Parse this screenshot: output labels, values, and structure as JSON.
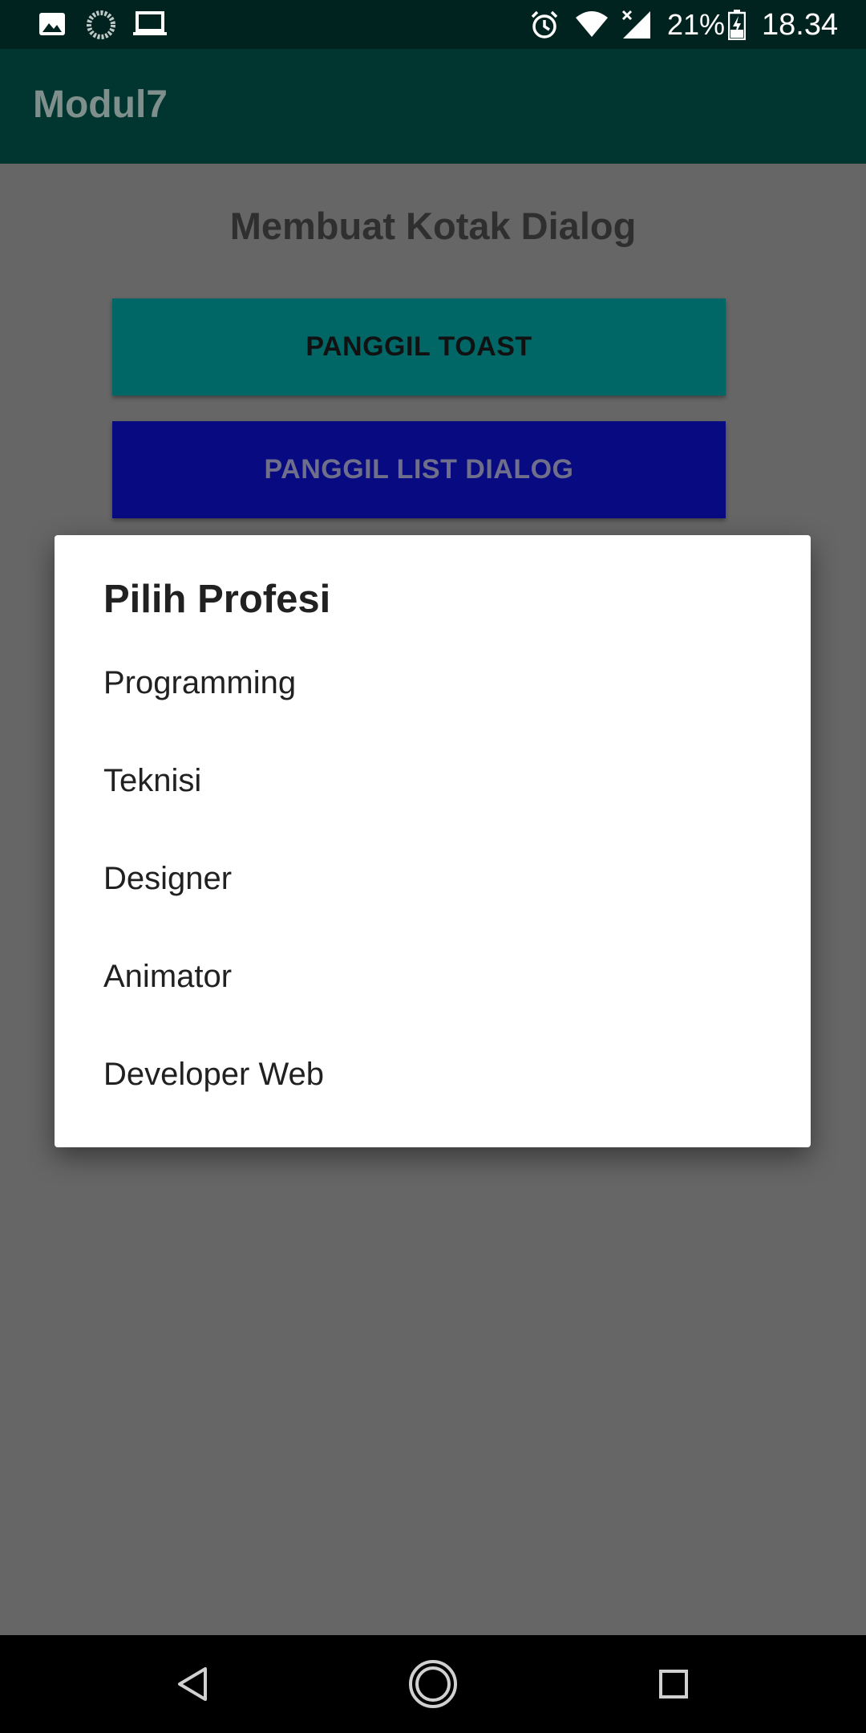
{
  "status_bar": {
    "battery_percent": "21%",
    "time": "18.34",
    "icons": [
      "image-icon",
      "loading-icon",
      "laptop-icon",
      "alarm-icon",
      "wifi-icon",
      "signal-icon",
      "battery-charging-icon"
    ]
  },
  "app_bar": {
    "title": "Modul7"
  },
  "main": {
    "heading": "Membuat Kotak Dialog",
    "buttons": {
      "toast": "PANGGIL TOAST",
      "list_dialog": "PANGGIL LIST DIALOG"
    }
  },
  "dialog": {
    "title": "Pilih Profesi",
    "items": [
      "Programming",
      "Teknisi",
      "Designer",
      "Animator",
      "Developer Web"
    ]
  },
  "nav_bar": {
    "icons": [
      "back-icon",
      "home-icon",
      "recents-icon"
    ]
  },
  "colors": {
    "status_bar": "#01231f",
    "app_bar": "#01352f",
    "scrim_background": "#666666",
    "toast_button": "#016666",
    "list_button": "#080a81",
    "dialog_background": "#ffffff"
  }
}
